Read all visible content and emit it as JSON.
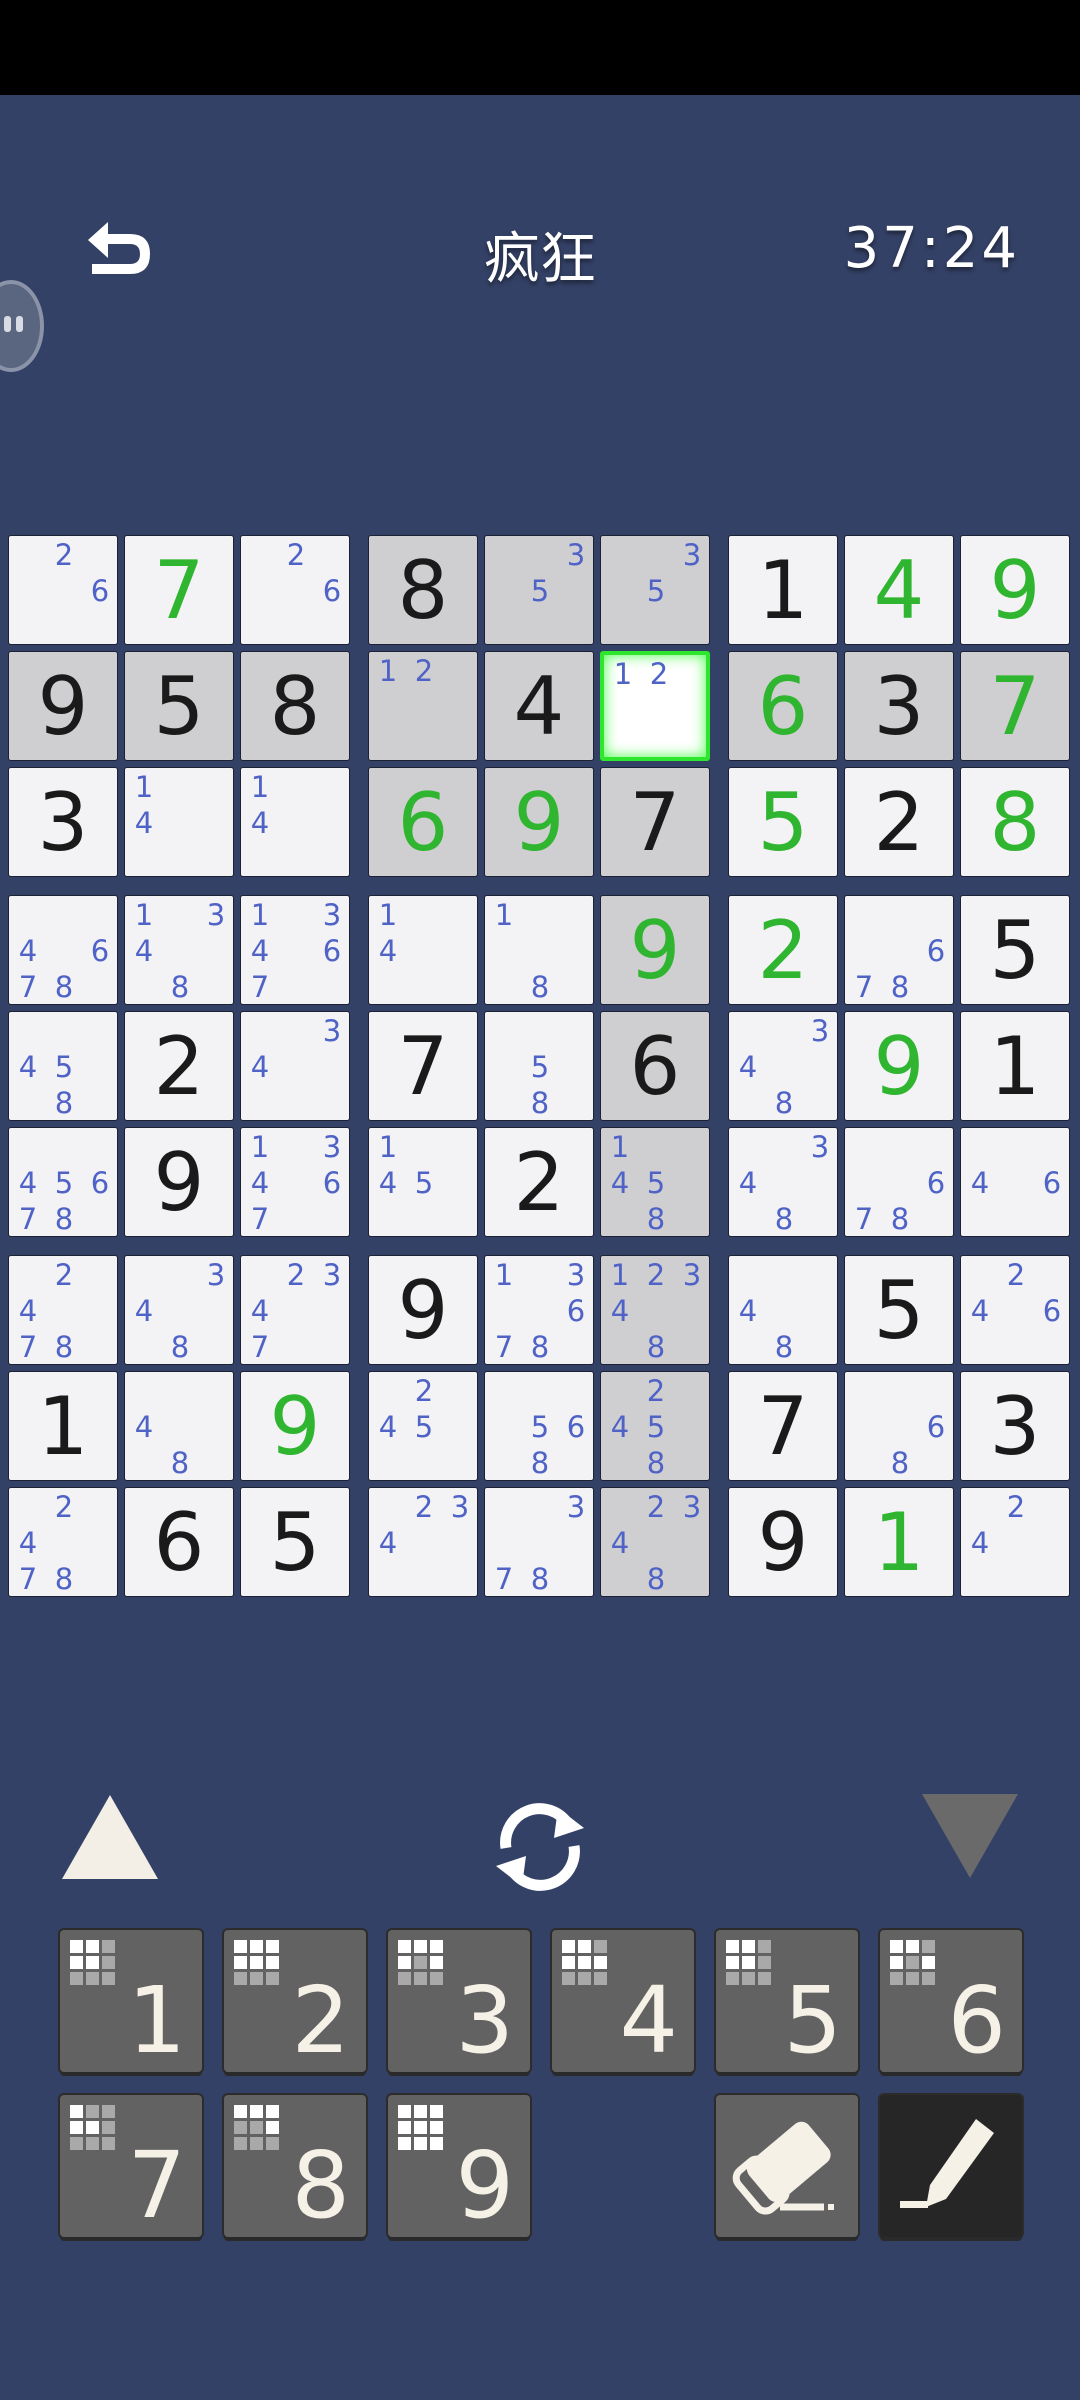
{
  "header": {
    "title": "疯狂",
    "timer": "37:24"
  },
  "board": {
    "selected": [
      1,
      5
    ],
    "highlight": [
      [
        0,
        3
      ],
      [
        0,
        4
      ],
      [
        0,
        5
      ],
      [
        1,
        0
      ],
      [
        1,
        1
      ],
      [
        1,
        2
      ],
      [
        1,
        3
      ],
      [
        1,
        4
      ],
      [
        1,
        6
      ],
      [
        1,
        7
      ],
      [
        1,
        8
      ],
      [
        2,
        3
      ],
      [
        2,
        4
      ],
      [
        2,
        5
      ],
      [
        3,
        5
      ],
      [
        4,
        5
      ],
      [
        5,
        5
      ],
      [
        6,
        5
      ],
      [
        7,
        5
      ],
      [
        8,
        5
      ]
    ],
    "cells": [
      [
        {
          "n": [
            2,
            6
          ]
        },
        {
          "v": 7,
          "u": 1
        },
        {
          "n": [
            2,
            6
          ]
        },
        {
          "v": 8
        },
        {
          "n": [
            3,
            5
          ]
        },
        {
          "n": [
            3,
            5
          ]
        },
        {
          "v": 1
        },
        {
          "v": 4,
          "u": 1
        },
        {
          "v": 9,
          "u": 1
        }
      ],
      [
        {
          "v": 9
        },
        {
          "v": 5
        },
        {
          "v": 8
        },
        {
          "n": [
            1,
            2
          ]
        },
        {
          "v": 4
        },
        {
          "n": [
            1,
            2
          ]
        },
        {
          "v": 6,
          "u": 1
        },
        {
          "v": 3
        },
        {
          "v": 7,
          "u": 1
        }
      ],
      [
        {
          "v": 3
        },
        {
          "n": [
            1,
            4
          ]
        },
        {
          "n": [
            1,
            4
          ]
        },
        {
          "v": 6,
          "u": 1
        },
        {
          "v": 9,
          "u": 1
        },
        {
          "v": 7
        },
        {
          "v": 5,
          "u": 1
        },
        {
          "v": 2
        },
        {
          "v": 8,
          "u": 1
        }
      ],
      [
        {
          "n": [
            4,
            6,
            7,
            8
          ]
        },
        {
          "n": [
            1,
            3,
            4,
            8
          ]
        },
        {
          "n": [
            1,
            3,
            4,
            6,
            7
          ]
        },
        {
          "n": [
            1,
            4
          ]
        },
        {
          "n": [
            1,
            8
          ]
        },
        {
          "v": 9,
          "u": 1
        },
        {
          "v": 2,
          "u": 1
        },
        {
          "n": [
            6,
            7,
            8
          ]
        },
        {
          "v": 5
        }
      ],
      [
        {
          "n": [
            4,
            5,
            8
          ]
        },
        {
          "v": 2
        },
        {
          "n": [
            3,
            4
          ]
        },
        {
          "v": 7
        },
        {
          "n": [
            5,
            8
          ]
        },
        {
          "v": 6
        },
        {
          "n": [
            3,
            4,
            8
          ]
        },
        {
          "v": 9,
          "u": 1
        },
        {
          "v": 1
        }
      ],
      [
        {
          "n": [
            4,
            5,
            6,
            7,
            8
          ]
        },
        {
          "v": 9
        },
        {
          "n": [
            1,
            3,
            4,
            6,
            7
          ]
        },
        {
          "n": [
            1,
            4,
            5
          ]
        },
        {
          "v": 2
        },
        {
          "n": [
            1,
            4,
            5,
            8
          ]
        },
        {
          "n": [
            3,
            4,
            8
          ]
        },
        {
          "n": [
            6,
            7,
            8
          ]
        },
        {
          "n": [
            4,
            6
          ]
        }
      ],
      [
        {
          "n": [
            2,
            4,
            7,
            8
          ]
        },
        {
          "n": [
            3,
            4,
            8
          ]
        },
        {
          "n": [
            2,
            3,
            4,
            7
          ]
        },
        {
          "v": 9
        },
        {
          "n": [
            1,
            3,
            6,
            7,
            8
          ]
        },
        {
          "n": [
            1,
            2,
            3,
            4,
            8
          ]
        },
        {
          "n": [
            4,
            8
          ]
        },
        {
          "v": 5
        },
        {
          "n": [
            2,
            4,
            6
          ]
        }
      ],
      [
        {
          "v": 1
        },
        {
          "n": [
            4,
            8
          ]
        },
        {
          "v": 9,
          "u": 1
        },
        {
          "n": [
            2,
            4,
            5
          ]
        },
        {
          "n": [
            5,
            6,
            8
          ]
        },
        {
          "n": [
            2,
            4,
            5,
            8
          ]
        },
        {
          "v": 7
        },
        {
          "n": [
            6,
            8
          ]
        },
        {
          "v": 3
        }
      ],
      [
        {
          "n": [
            2,
            4,
            7,
            8
          ]
        },
        {
          "v": 6
        },
        {
          "v": 5
        },
        {
          "n": [
            2,
            3,
            4
          ]
        },
        {
          "n": [
            3,
            7,
            8
          ]
        },
        {
          "n": [
            2,
            3,
            4,
            8
          ]
        },
        {
          "v": 9
        },
        {
          "v": 1,
          "u": 1
        },
        {
          "n": [
            2,
            4
          ]
        }
      ]
    ]
  },
  "keypad": {
    "numbers": [
      {
        "label": "1",
        "mini": [
          1,
          1,
          0,
          1,
          1,
          0,
          0,
          0,
          0
        ]
      },
      {
        "label": "2",
        "mini": [
          1,
          1,
          1,
          1,
          1,
          1,
          0,
          0,
          0
        ]
      },
      {
        "label": "3",
        "mini": [
          1,
          1,
          1,
          1,
          0,
          1,
          0,
          0,
          0
        ]
      },
      {
        "label": "4",
        "mini": [
          1,
          1,
          0,
          1,
          1,
          1,
          0,
          0,
          0
        ]
      },
      {
        "label": "5",
        "mini": [
          1,
          1,
          0,
          1,
          1,
          0,
          0,
          0,
          0
        ]
      },
      {
        "label": "6",
        "mini": [
          1,
          1,
          0,
          1,
          0,
          1,
          0,
          0,
          0
        ]
      },
      {
        "label": "7",
        "mini": [
          1,
          0,
          0,
          1,
          1,
          0,
          0,
          0,
          0
        ]
      },
      {
        "label": "8",
        "mini": [
          1,
          1,
          1,
          0,
          0,
          1,
          0,
          0,
          0
        ]
      },
      {
        "label": "9",
        "mini": [
          1,
          1,
          1,
          1,
          1,
          1,
          1,
          1,
          1
        ]
      }
    ],
    "eraser_icon": "eraser-icon",
    "pencil_icon": "pencil-icon"
  },
  "colors": {
    "background": "#344166",
    "given": "#1a1a1a",
    "user": "#2fb52f",
    "note": "#4f63c7",
    "selected_border": "#2ee62e"
  }
}
